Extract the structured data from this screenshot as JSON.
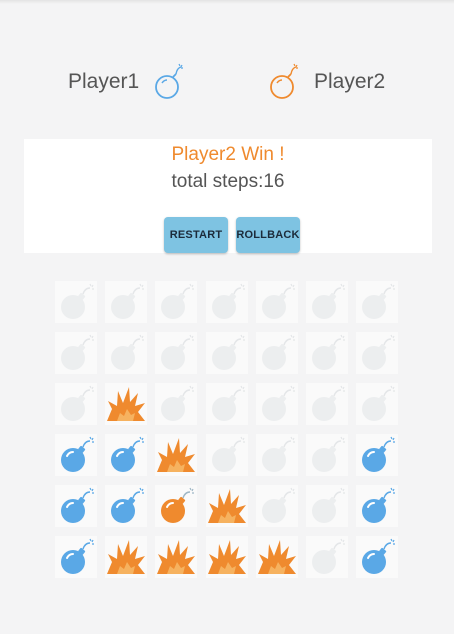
{
  "players": {
    "p1": {
      "name": "Player1",
      "icon": "blue-bomb-outline-icon",
      "color": "#5aa8e6"
    },
    "p2": {
      "name": "Player2",
      "icon": "orange-bomb-outline-icon",
      "color": "#ef8a2e"
    }
  },
  "status": {
    "text": "Player2 Win !",
    "color": "#ef8a2e"
  },
  "steps_text": "total steps:16",
  "buttons": {
    "restart": {
      "label": "RESTART",
      "color": "#7ec3e2"
    },
    "rollback": {
      "label": "ROLLBACK",
      "color": "#7ec3e2"
    }
  },
  "board": {
    "rows": 6,
    "cols": 7,
    "legend": {
      "E": "empty-grey-bomb",
      "B": "blue-bomb",
      "O": "orange-bomb",
      "X": "orange-explosion"
    },
    "grid": [
      [
        "E",
        "E",
        "E",
        "E",
        "E",
        "E",
        "E"
      ],
      [
        "E",
        "E",
        "E",
        "E",
        "E",
        "E",
        "E"
      ],
      [
        "E",
        "X",
        "E",
        "E",
        "E",
        "E",
        "E"
      ],
      [
        "B",
        "B",
        "X",
        "E",
        "E",
        "E",
        "B"
      ],
      [
        "B",
        "B",
        "O",
        "X",
        "E",
        "E",
        "B"
      ],
      [
        "B",
        "X",
        "X",
        "X",
        "X",
        "E",
        "B"
      ]
    ]
  },
  "colors": {
    "empty": "#eceeef",
    "blue": "#5aa8e6",
    "orange": "#ef8a2e",
    "fuse": "#9fb7c6"
  }
}
